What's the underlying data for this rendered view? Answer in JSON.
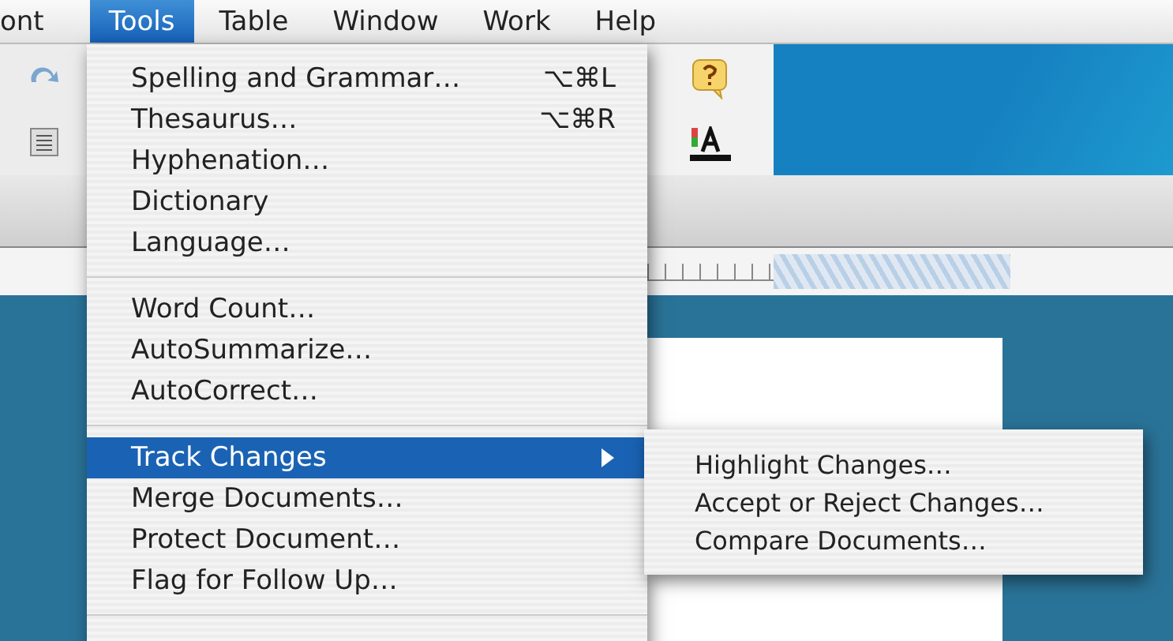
{
  "menubar": {
    "items": [
      {
        "label": "ont",
        "selected": false
      },
      {
        "label": "Tools",
        "selected": true
      },
      {
        "label": "Table",
        "selected": false
      },
      {
        "label": "Window",
        "selected": false
      },
      {
        "label": "Work",
        "selected": false
      },
      {
        "label": "Help",
        "selected": false
      }
    ]
  },
  "menu": {
    "items": [
      {
        "kind": "item",
        "label": "Spelling and Grammar…",
        "shortcut": "⌥⌘L",
        "selected": false
      },
      {
        "kind": "item",
        "label": "Thesaurus…",
        "shortcut": "⌥⌘R",
        "selected": false
      },
      {
        "kind": "item",
        "label": "Hyphenation…",
        "selected": false
      },
      {
        "kind": "item",
        "label": "Dictionary",
        "selected": false
      },
      {
        "kind": "item",
        "label": "Language…",
        "selected": false
      },
      {
        "kind": "separator"
      },
      {
        "kind": "item",
        "label": "Word Count…",
        "selected": false
      },
      {
        "kind": "item",
        "label": "AutoSummarize…",
        "selected": false
      },
      {
        "kind": "item",
        "label": "AutoCorrect…",
        "selected": false
      },
      {
        "kind": "separator"
      },
      {
        "kind": "submenu",
        "label": "Track Changes",
        "selected": true
      },
      {
        "kind": "item",
        "label": "Merge Documents…",
        "selected": false
      },
      {
        "kind": "item",
        "label": "Protect Document…",
        "selected": false
      },
      {
        "kind": "item",
        "label": "Flag for Follow Up…",
        "selected": false
      },
      {
        "kind": "separator"
      }
    ]
  },
  "submenu": {
    "items": [
      {
        "label": "Highlight Changes…"
      },
      {
        "label": "Accept or Reject Changes…"
      },
      {
        "label": "Compare Documents…"
      }
    ]
  }
}
